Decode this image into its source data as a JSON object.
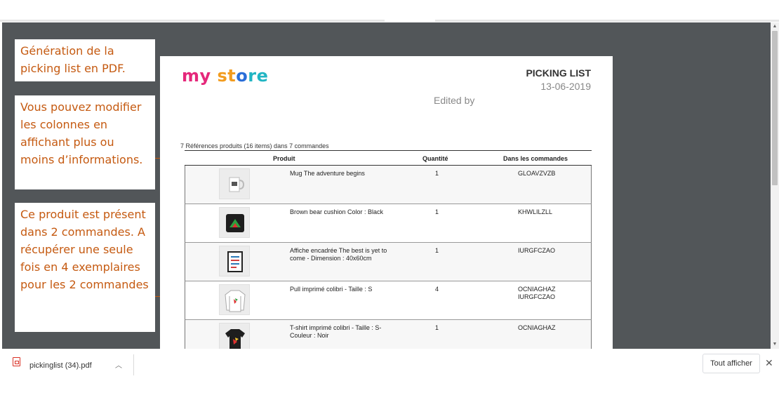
{
  "annotations": {
    "note1": "Génération de la picking list en PDF.",
    "note2": "Vous pouvez modifier les colonnes en affichant plus ou moins d’informations.",
    "note3": "Ce produit est présent dans 2 commandes. A récupérer une seule fois en 4 exemplaires pour les 2 commandes"
  },
  "doc": {
    "logo": [
      "my ",
      "st",
      "o",
      "re"
    ],
    "title": "PICKING LIST",
    "date": "13-06-2019",
    "edited_by": "Edited by",
    "summary": "7 Références produits (16 items) dans 7 commandes",
    "columns": {
      "product": "Produit",
      "quantity": "Quantité",
      "orders": "Dans les commandes"
    },
    "rows": [
      {
        "name": "Mug The adventure begins",
        "qty": "1",
        "orders": "GLOAVZVZB",
        "icon": "mug-icon"
      },
      {
        "name": "Brown bear cushion Color : Black",
        "qty": "1",
        "orders": "KHWLILZLL",
        "icon": "cushion-icon"
      },
      {
        "name": "Affiche encadrée The best is yet to come - Dimension : 40x60cm",
        "qty": "1",
        "orders": "IURGFCZAO",
        "icon": "poster-icon"
      },
      {
        "name": "Pull imprimé colibri - Taille : S",
        "qty": "4",
        "orders": "OCNIAGHAZ\nIURGFCZAO",
        "icon": "sweater-icon"
      },
      {
        "name": "T-shirt imprimé colibri - Taille : S- Couleur : Noir",
        "qty": "1",
        "orders": "OCNIAGHAZ",
        "icon": "tshirt-icon"
      }
    ]
  },
  "downloads": {
    "file": "pickinglist (34).pdf",
    "show_all": "Tout afficher"
  },
  "colors": {
    "annotation": "#c55a11",
    "viewer_bg": "#525659"
  }
}
